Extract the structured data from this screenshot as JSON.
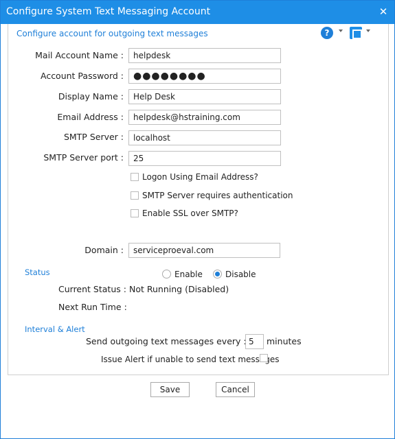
{
  "window": {
    "title": "Configure System Text Messaging Account"
  },
  "header": {
    "subtitle": "Configure account for outgoing text messages",
    "help_icon_text": "?"
  },
  "fields": {
    "mail_account_name": {
      "label": "Mail Account Name :",
      "value": "helpdesk"
    },
    "account_password": {
      "label": "Account Password :",
      "value": "●●●●●●●●"
    },
    "display_name": {
      "label": "Display Name :",
      "value": "Help Desk"
    },
    "email_address": {
      "label": "Email Address :",
      "value": "helpdesk@hstraining.com"
    },
    "smtp_server": {
      "label": "SMTP Server :",
      "value": "localhost"
    },
    "smtp_port": {
      "label": "SMTP Server port :",
      "value": "25"
    },
    "domain": {
      "label": "Domain :",
      "value": "serviceproeval.com"
    }
  },
  "options": {
    "logon_email": {
      "label": "Logon Using Email Address?",
      "checked": false
    },
    "smtp_auth": {
      "label": "SMTP Server requires authentication",
      "checked": false
    },
    "enable_ssl": {
      "label": "Enable SSL over SMTP?",
      "checked": false
    }
  },
  "status": {
    "heading": "Status",
    "enable_label": "Enable",
    "disable_label": "Disable",
    "selected": "Disable",
    "current_status_label": "Current Status :",
    "current_status_value": "Not Running (Disabled)",
    "next_run_label": "Next Run Time :",
    "next_run_value": ""
  },
  "interval": {
    "heading": "Interval & Alert",
    "send_label": "Send outgoing text messages every :",
    "minutes_value": "5",
    "minutes_label": "minutes",
    "alert_label": "Issue Alert if unable to send text messages",
    "alert_checked": false
  },
  "buttons": {
    "save": "Save",
    "cancel": "Cancel"
  },
  "colors": {
    "accent": "#1e8ee6",
    "heading": "#1e7fd8"
  }
}
